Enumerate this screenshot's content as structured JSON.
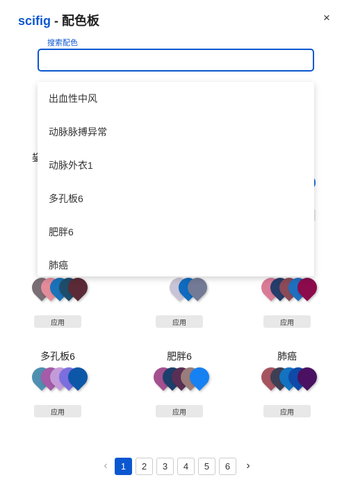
{
  "header": {
    "brand": "scifig",
    "title_rest": " - 配色板",
    "close_label": "×"
  },
  "search": {
    "label": "搜索配色",
    "value": "",
    "placeholder": ""
  },
  "dropdown": {
    "items": [
      "出血性中风",
      "动脉脉搏异常",
      "动脉外衣1",
      "多孔板6",
      "肥胖6",
      "肺癌"
    ]
  },
  "background_partial": {
    "text": "鋆"
  },
  "cards": [
    {
      "name": "",
      "apply_label": "应用",
      "colors": [
        "#7a6e75",
        "#e48b9a",
        "#1a72b8",
        "#1e4d6b",
        "#5b2a36"
      ]
    },
    {
      "name": "",
      "apply_label": "应用",
      "colors": [
        "#c9c3d6",
        "#0e6bbf",
        "#727a95"
      ]
    },
    {
      "name": "",
      "apply_label": "应用",
      "colors": [
        "#d97b96",
        "#243d6b",
        "#8b4a57",
        "#1f6fbf",
        "#8c0b4c"
      ]
    },
    {
      "name": "多孔板6",
      "apply_label": "应用",
      "colors": [
        "#4e8fb0",
        "#a65ba8",
        "#c49bd9",
        "#7b6fe0",
        "#0c57a8"
      ]
    },
    {
      "name": "肥胖6",
      "apply_label": "应用",
      "colors": [
        "#a4508f",
        "#1d3f6b",
        "#5a2f55",
        "#9a7d7a",
        "#1681f2"
      ]
    },
    {
      "name": "肺癌",
      "apply_label": "应用",
      "colors": [
        "#a5545f",
        "#3e3f55",
        "#1373c2",
        "#0f4aa8",
        "#4a1061"
      ]
    }
  ],
  "pagination": {
    "prev": "‹",
    "next": "›",
    "pages": [
      "1",
      "2",
      "3",
      "4",
      "5",
      "6"
    ],
    "current": "1"
  }
}
